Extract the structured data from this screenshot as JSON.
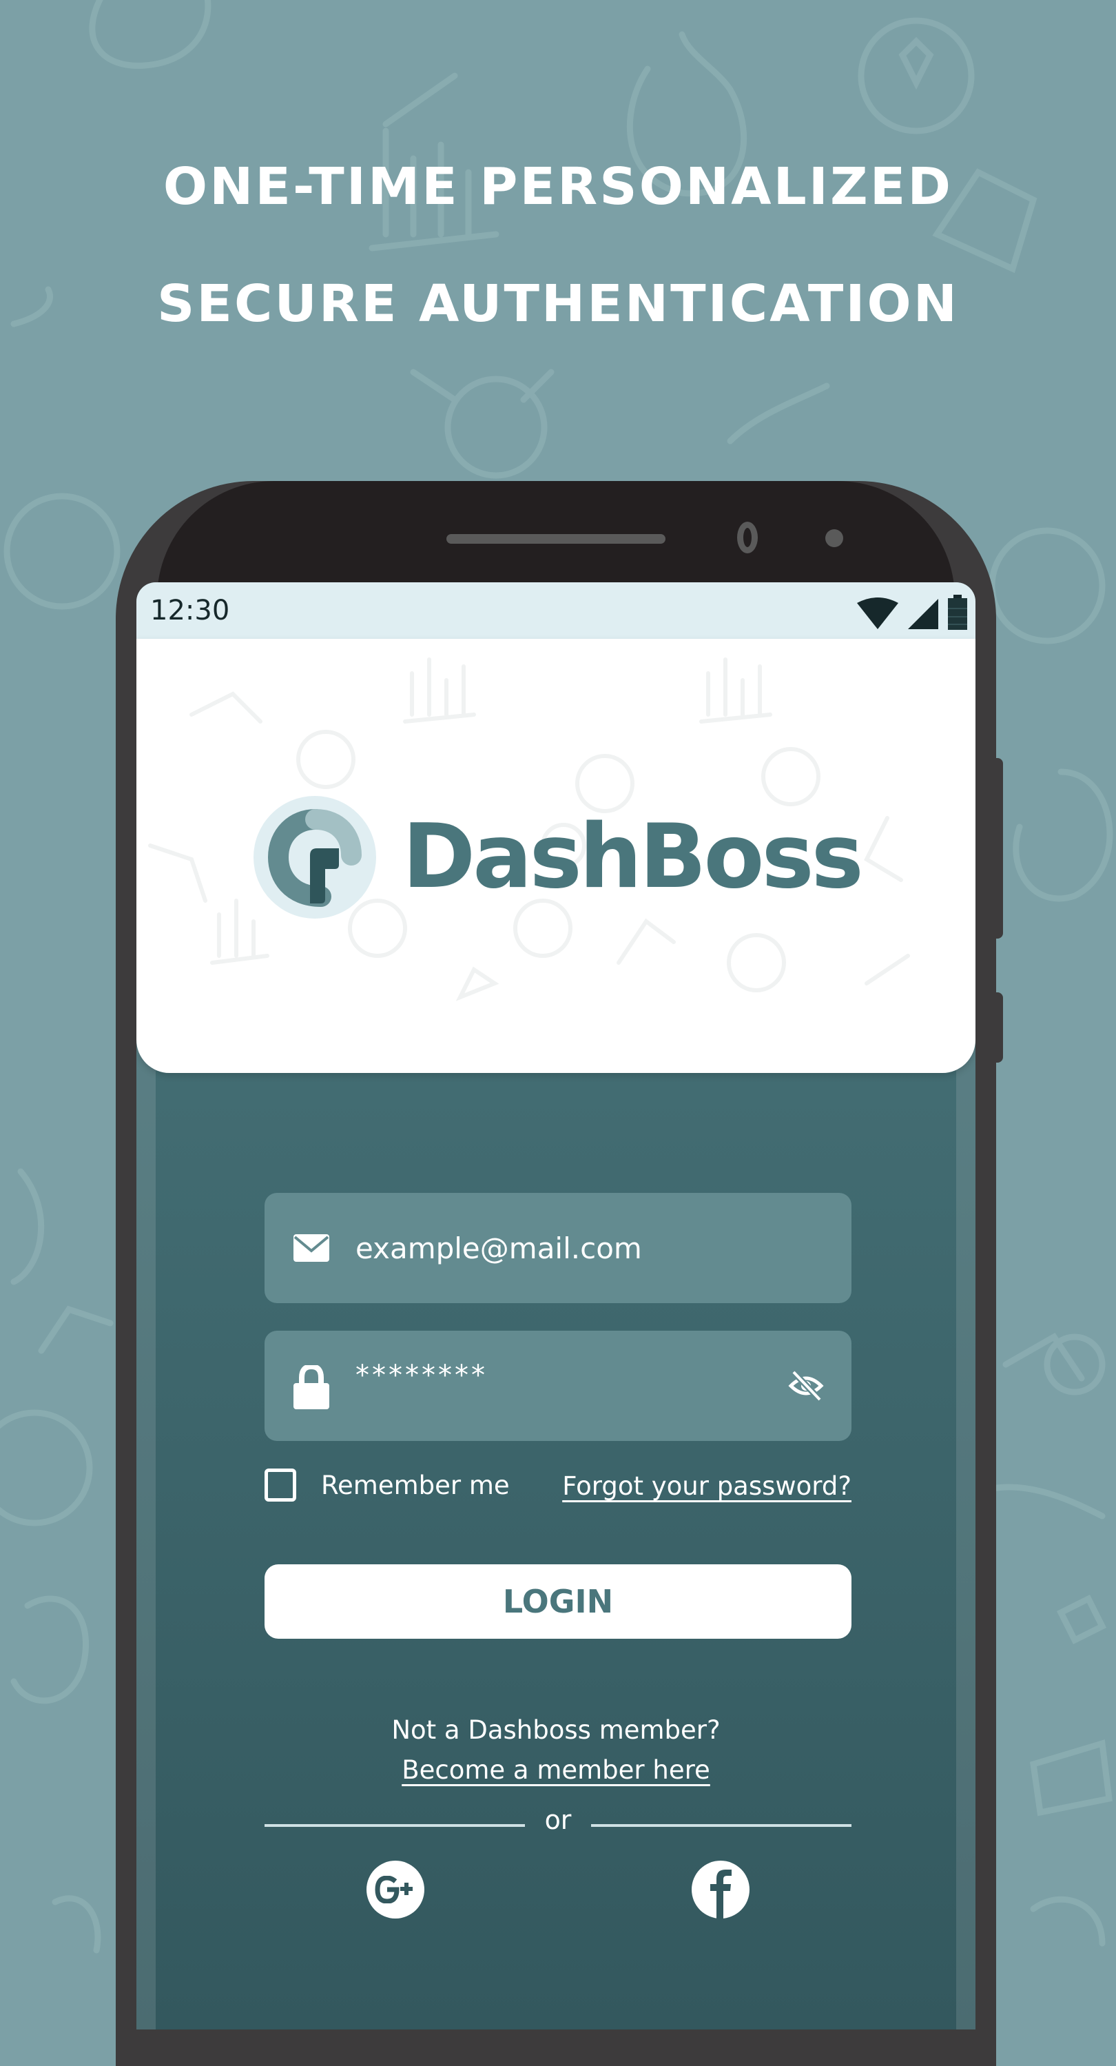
{
  "headline": {
    "line1": "ONE-TIME PERSONALIZED",
    "line2": "SECURE AUTHENTICATION"
  },
  "status_bar": {
    "time": "12:30",
    "icons": [
      "wifi-icon",
      "signal-icon",
      "battery-icon"
    ]
  },
  "brand": {
    "name": "DashBoss",
    "logo_icon": "dashboss-logo-icon"
  },
  "login_form": {
    "email": {
      "icon": "mail-icon",
      "value": "example@mail.com"
    },
    "password": {
      "icon": "lock-icon",
      "value": "********",
      "toggle_icon": "eye-slash-icon"
    },
    "remember_me": {
      "label": "Remember me",
      "checked": false
    },
    "forgot_password_link": "Forgot your password?",
    "login_button": "LOGIN"
  },
  "signup": {
    "prompt": "Not a Dashboss member?",
    "link": "Become a member here"
  },
  "divider_text": "or",
  "social_login": [
    {
      "name": "google-plus",
      "icon": "google-plus-icon"
    },
    {
      "name": "facebook",
      "icon": "facebook-icon"
    }
  ],
  "colors": {
    "background": "#7ca0a6",
    "primary": "#4a767c",
    "field_bg": "#638b90",
    "status_bar": "#dfeef2",
    "phone_frame": "#3d3b3c",
    "phone_top": "#231f20"
  }
}
